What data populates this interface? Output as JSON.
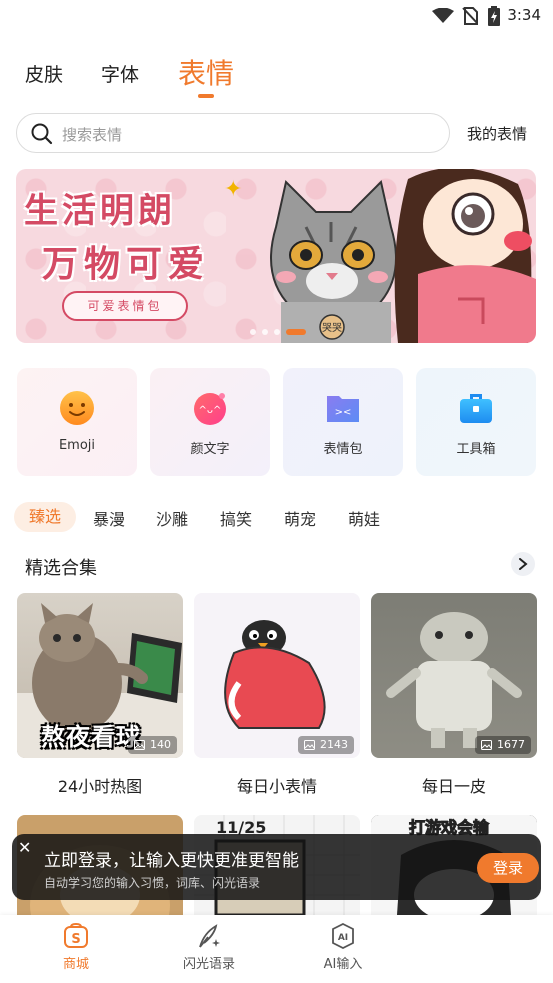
{
  "status_bar": {
    "time": "3:34"
  },
  "top_tabs": [
    {
      "label": "皮肤"
    },
    {
      "label": "字体"
    },
    {
      "label": "表情",
      "active": true
    }
  ],
  "search": {
    "placeholder": "搜索表情",
    "my_emoji": "我的表情"
  },
  "banner": {
    "line1": "生活明朗",
    "line2": "万物可爱",
    "tag": "可爱表情包",
    "cat_tag": "哭哭",
    "page_count": 4,
    "active_index": 3
  },
  "categories": [
    {
      "label": "Emoji",
      "icon": "emoji-smile-icon"
    },
    {
      "label": "颜文字",
      "icon": "kaomoji-icon"
    },
    {
      "label": "表情包",
      "icon": "sticker-folder-icon"
    },
    {
      "label": "工具箱",
      "icon": "toolbox-icon"
    }
  ],
  "sub_tabs": [
    {
      "label": "臻选",
      "active": true
    },
    {
      "label": "暴漫"
    },
    {
      "label": "沙雕"
    },
    {
      "label": "搞笑"
    },
    {
      "label": "萌宠"
    },
    {
      "label": "萌娃"
    }
  ],
  "section": {
    "title": "精选合集"
  },
  "collections": [
    {
      "name": "24小时热图",
      "count": "140",
      "overlay": "熬夜看球"
    },
    {
      "name": "每日小表情",
      "count": "2143"
    },
    {
      "name": "每日一皮",
      "count": "1677"
    }
  ],
  "second_row": {
    "p1_text": "11/25",
    "p2_text": "打游戏会输"
  },
  "login_toast": {
    "title": "立即登录，让输入更快更准更智能",
    "desc": "自动学习您的输入习惯，词库、闪光语录",
    "button": "登录"
  },
  "bottom_nav": [
    {
      "label": "商城",
      "active": true,
      "icon": "store-icon"
    },
    {
      "label": "闪光语录",
      "icon": "quill-sparkle-icon"
    },
    {
      "label": "AI输入",
      "icon": "ai-icon"
    }
  ],
  "colors": {
    "accent": "#f07a2d",
    "banner_text": "#d44a64"
  }
}
